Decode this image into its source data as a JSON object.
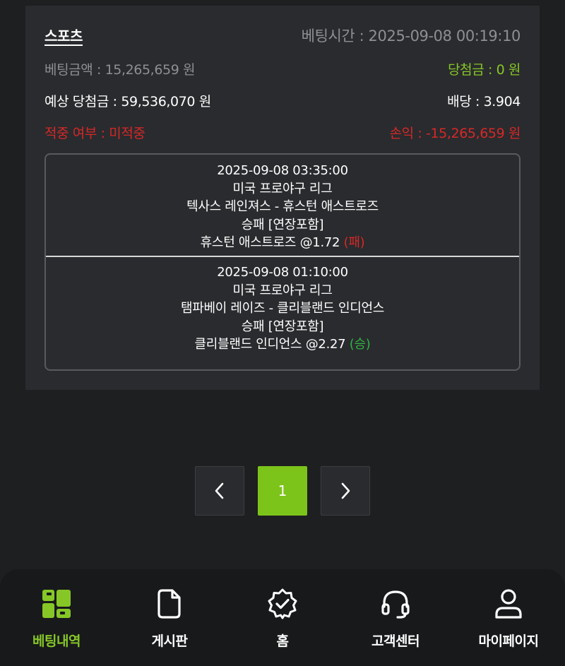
{
  "bet": {
    "category": "스포츠",
    "bet_time": "베팅시간 : 2025-09-08 00:19:10",
    "bet_amount": "베팅금액 : 15,265,659 원",
    "win_amount": "당첨금 : 0 원",
    "expected_win": "예상 당첨금 : 59,536,070 원",
    "odds": "배당 : 3.904",
    "hit_status": "적중 여부 : 미적중",
    "profit": "손익 : -15,265,659 원",
    "matches": [
      {
        "datetime": "2025-09-08 03:35:00",
        "league": "미국 프로야구 리그",
        "teams": "텍사스 레인져스 - 휴스턴 애스트로즈",
        "market": "승패 [연장포함]",
        "pick": "휴스턴 애스트로즈 @1.72 ",
        "result": "(패)"
      },
      {
        "datetime": "2025-09-08 01:10:00",
        "league": "미국 프로야구 리그",
        "teams": "탬파베이 레이즈 - 클리블랜드 인디언스",
        "market": "승패 [연장포함]",
        "pick": "클리블랜드 인디언스 @2.27 ",
        "result": "(승)"
      }
    ]
  },
  "pagination": {
    "prev": "<",
    "current": "1",
    "next": ">"
  },
  "nav": [
    {
      "label": "베팅내역",
      "icon": "bet-history-icon",
      "active": true
    },
    {
      "label": "게시판",
      "icon": "document-icon",
      "active": false
    },
    {
      "label": "홈",
      "icon": "badge-check-icon",
      "active": false
    },
    {
      "label": "고객센터",
      "icon": "headset-icon",
      "active": false
    },
    {
      "label": "마이페이지",
      "icon": "user-icon",
      "active": false
    }
  ],
  "colors": {
    "accent": "#86c727",
    "loss": "#d62828",
    "win": "#2fb344",
    "background": "#1e1f21",
    "card": "#2a2b2e"
  }
}
